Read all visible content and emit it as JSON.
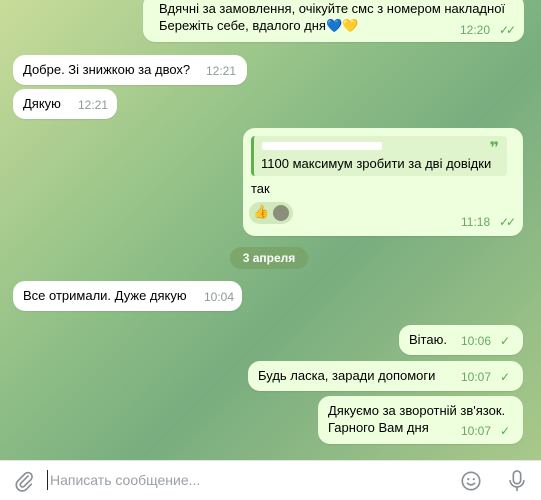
{
  "messages": [
    {
      "id": "m0",
      "text": "Вдячні за замовлення, очікуйте смс з номером накладної\nБережіть себе, вдалого дня💙💛",
      "time": "12:20",
      "ticks": "✓✓"
    },
    {
      "id": "m1",
      "text": "Добре. Зі знижкою за двох?",
      "time": "12:21"
    },
    {
      "id": "m2",
      "text": "Дякую",
      "time": "12:21"
    },
    {
      "id": "m3",
      "reply_quote": "1100 максимум зробити за дві довідки",
      "text": "так",
      "reaction": "👍",
      "time": "11:18",
      "ticks": "✓✓"
    },
    {
      "id": "m4",
      "text": "Все отримали. Дуже дякую",
      "time": "10:04"
    },
    {
      "id": "m5",
      "text": "Вітаю.",
      "time": "10:06",
      "ticks": "✓"
    },
    {
      "id": "m6",
      "text": "Будь ласка, заради допомоги",
      "time": "10:07",
      "ticks": "✓"
    },
    {
      "id": "m7",
      "text": "Дякуємо за зворотній зв'язок.\nГарного Вам дня",
      "time": "10:07",
      "ticks": "✓"
    }
  ],
  "date_separator": "3 апреля",
  "input": {
    "placeholder": "Написать сообщение..."
  },
  "icons": {
    "attach": "paperclip-icon",
    "emoji": "smiley-icon",
    "mic": "microphone-icon"
  },
  "colors": {
    "incoming": "#ffffff",
    "outgoing": "#eeffde",
    "accent": "#4fae4e",
    "date_pill": "#78a064"
  }
}
